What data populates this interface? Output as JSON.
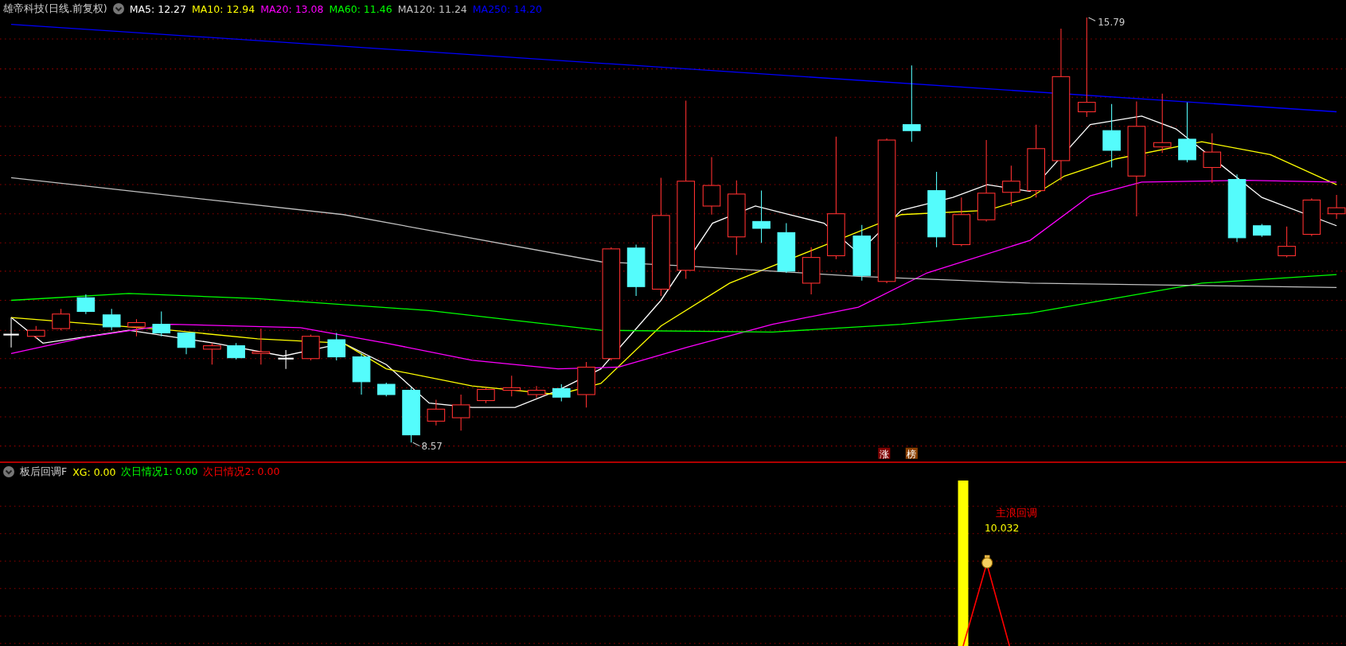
{
  "main_panel": {
    "title": "雄帝科技(日线.前复权)",
    "indicators": [
      {
        "text": "MA5: 12.27",
        "color": "#ffffff"
      },
      {
        "text": "MA10: 12.94",
        "color": "#ffff00"
      },
      {
        "text": "MA20: 13.08",
        "color": "#ff00ff"
      },
      {
        "text": "MA60: 11.46",
        "color": "#00ff00"
      },
      {
        "text": "MA120: 11.24",
        "color": "#c0c0c0"
      },
      {
        "text": "MA250: 14.20",
        "color": "#0000ff"
      }
    ],
    "high_label": "15.79",
    "low_label": "8.57",
    "badges": [
      {
        "text": "涨",
        "color": "#800000"
      },
      {
        "text": "榜",
        "color": "#8b4000"
      }
    ]
  },
  "sub_panel": {
    "title": "板后回调F",
    "indicators": [
      {
        "text": "XG: 0.00",
        "color": "#ffff00"
      },
      {
        "text": "次日情况1: 0.00",
        "color": "#00ff00"
      },
      {
        "text": "次日情况2: 0.00",
        "color": "#ff0000"
      }
    ],
    "signal_label": "主浪回调",
    "signal_value": "10.032"
  }
}
